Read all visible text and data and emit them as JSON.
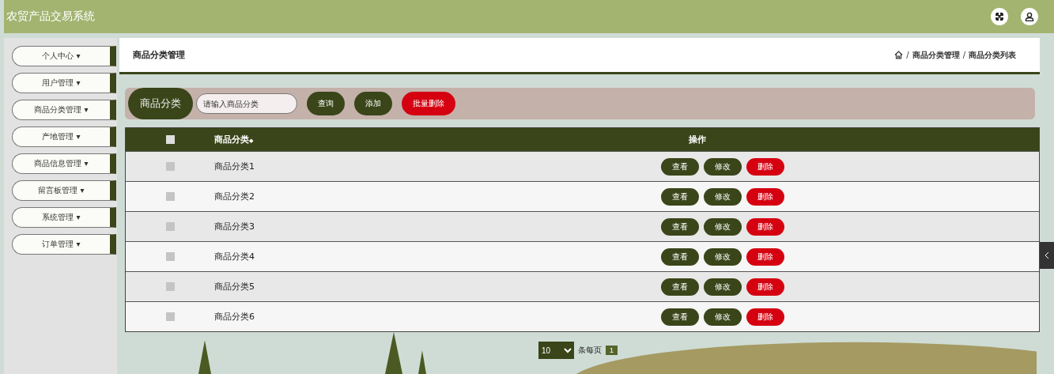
{
  "header": {
    "title": "农贸产品交易系统"
  },
  "sidebar": {
    "items": [
      {
        "label": "个人中心",
        "caret": "▾",
        "selected": false
      },
      {
        "label": "用户管理",
        "caret": "▾",
        "selected": false
      },
      {
        "label": "商品分类管理",
        "caret": "▾",
        "selected": false
      },
      {
        "label": "产地管理",
        "caret": "▾",
        "selected": false
      },
      {
        "label": "商品信息管理",
        "caret": "▾",
        "selected": false
      },
      {
        "label": "留言板管理",
        "caret": "▾",
        "selected": false
      },
      {
        "label": "系统管理",
        "caret": "▾",
        "selected": false
      },
      {
        "label": "订单管理",
        "caret": "▾",
        "selected": false
      }
    ]
  },
  "page_title": "商品分类管理",
  "breadcrumb": [
    {
      "separator": "/",
      "label": "商品分类管理"
    },
    {
      "separator": "/",
      "label": "商品分类列表"
    }
  ],
  "search": {
    "label": "商品分类",
    "placeholder": "请输入商品分类",
    "buttons": [
      {
        "label": "查询",
        "kind": "normal"
      },
      {
        "label": "添加",
        "kind": "normal"
      },
      {
        "label": "批量删除",
        "kind": "danger"
      }
    ]
  },
  "table": {
    "select_all_checked": false,
    "columns": [
      "商品分类",
      "操作"
    ],
    "sort_mark": "◆",
    "rows": [
      {
        "name": "商品分类1",
        "checked": false,
        "actions": [
          {
            "label": "查看",
            "kind": "normal"
          },
          {
            "label": "修改",
            "kind": "normal"
          },
          {
            "label": "删除",
            "kind": "danger"
          }
        ]
      },
      {
        "name": "商品分类2",
        "checked": false,
        "actions": [
          {
            "label": "查看",
            "kind": "normal"
          },
          {
            "label": "修改",
            "kind": "normal"
          },
          {
            "label": "删除",
            "kind": "danger"
          }
        ]
      },
      {
        "name": "商品分类3",
        "checked": false,
        "actions": [
          {
            "label": "查看",
            "kind": "normal"
          },
          {
            "label": "修改",
            "kind": "normal"
          },
          {
            "label": "删除",
            "kind": "danger"
          }
        ]
      },
      {
        "name": "商品分类4",
        "checked": false,
        "actions": [
          {
            "label": "查看",
            "kind": "normal"
          },
          {
            "label": "修改",
            "kind": "normal"
          },
          {
            "label": "删除",
            "kind": "danger"
          }
        ]
      },
      {
        "name": "商品分类5",
        "checked": false,
        "actions": [
          {
            "label": "查看",
            "kind": "normal"
          },
          {
            "label": "修改",
            "kind": "normal"
          },
          {
            "label": "删除",
            "kind": "danger"
          }
        ]
      },
      {
        "name": "商品分类6",
        "checked": false,
        "actions": [
          {
            "label": "查看",
            "kind": "normal"
          },
          {
            "label": "修改",
            "kind": "normal"
          },
          {
            "label": "删除",
            "kind": "danger"
          }
        ]
      }
    ]
  },
  "pagination": {
    "page_size": "10",
    "per_page_label": "条每页",
    "pages": [
      {
        "label": "1",
        "selected": true
      }
    ]
  }
}
